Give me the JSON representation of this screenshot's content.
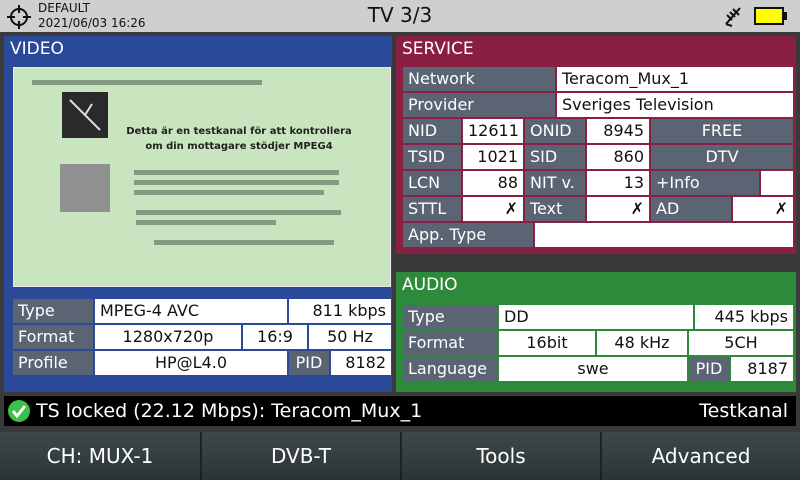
{
  "header": {
    "preset": "DEFAULT",
    "datetime": "2021/06/03 16:26",
    "title": "TV 3/3",
    "icons": [
      "crosshair-icon",
      "antenna-icon",
      "battery-icon"
    ],
    "battery_color": "#ffff00"
  },
  "video": {
    "tab": "VIDEO",
    "preview_heading": "Detta är en testkanal för att kontrollera om din mottagare stödjer MPEG4",
    "labels": {
      "type": "Type",
      "format": "Format",
      "profile": "Profile",
      "pid": "PID"
    },
    "values": {
      "codec": "MPEG-4 AVC",
      "bitrate": "811 kbps",
      "resolution": "1280x720p",
      "aspect": "16:9",
      "framerate": "50 Hz",
      "profile": "HP@L4.0",
      "pid": "8182"
    },
    "color": "#2a4a99"
  },
  "service": {
    "tab": "SERVICE",
    "labels": {
      "network": "Network",
      "provider": "Provider",
      "nid": "NID",
      "onid": "ONID",
      "tsid": "TSID",
      "sid": "SID",
      "lcn": "LCN",
      "nitv": "NIT v.",
      "stt": "STTL",
      "text": "Text",
      "ad": "AD",
      "apptype": "App. Type",
      "info": "+Info"
    },
    "values": {
      "network": "Teracom_Mux_1",
      "provider": "Sveriges Television",
      "nid": "12611",
      "onid": "8945",
      "free": "FREE",
      "tsid": "1021",
      "sid": "860",
      "dtv": "DTV",
      "lcn": "88",
      "nitv": "13",
      "info": "",
      "stt": "✗",
      "text": "✗",
      "ad": "✗",
      "apptype": ""
    },
    "color": "#8a1f44"
  },
  "audio": {
    "tab": "AUDIO",
    "labels": {
      "type": "Type",
      "format": "Format",
      "language": "Language",
      "pid": "PID"
    },
    "values": {
      "codec": "DD",
      "bitrate": "445 kbps",
      "bits": "16bit",
      "rate": "48 kHz",
      "channels": "5CH",
      "language": "swe",
      "pid": "8187"
    },
    "color": "#2c8a3a"
  },
  "status": {
    "message": "TS locked (22.12 Mbps): Teracom_Mux_1",
    "program": "Testkanal",
    "lock_color": "#3cc04a"
  },
  "softkeys": [
    "CH: MUX-1",
    "DVB-T",
    "Tools",
    "Advanced"
  ]
}
